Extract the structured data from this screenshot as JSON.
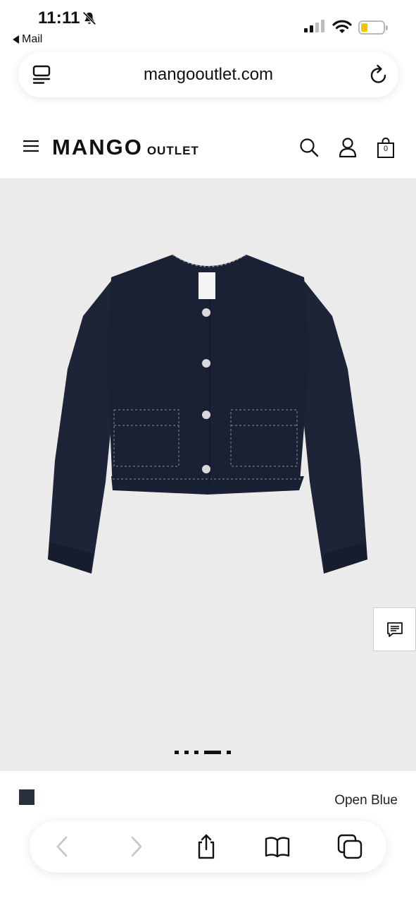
{
  "status_bar": {
    "time": "11:11",
    "back_app": "Mail",
    "battery_color": "#f5c400"
  },
  "browser": {
    "url": "mangooutlet.com",
    "icons": [
      "tab-overview-icon",
      "reload-icon"
    ]
  },
  "site_header": {
    "brand": "MANGO",
    "sub_brand": "OUTLET",
    "bag_count": "0",
    "icons": [
      "menu-icon",
      "search-icon",
      "user-icon",
      "shopping-bag-icon"
    ]
  },
  "product": {
    "image_background": "#ebebeb",
    "gallery_images": 5,
    "active_image": 4,
    "jacket_color": "#1e2438"
  },
  "color_selector": {
    "swatch_color": "#2a2f3d",
    "selected_color_name": "Open Blue"
  },
  "toolbar": {
    "icons": [
      "back-icon",
      "forward-icon",
      "share-icon",
      "bookmarks-icon",
      "tabs-icon"
    ]
  }
}
